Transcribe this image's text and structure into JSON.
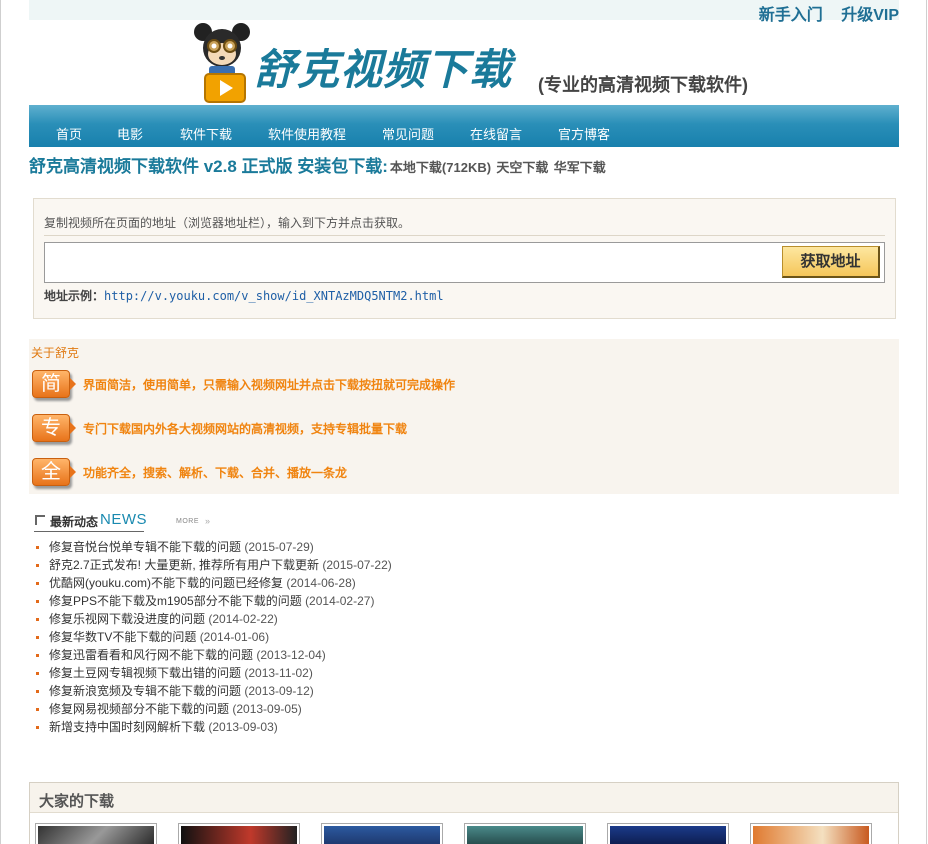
{
  "top_links": {
    "newbie": "新手入门",
    "vip": "升级VIP"
  },
  "logo": {
    "title": "舒克视频下载",
    "subtitle": "(专业的高清视频下载软件)"
  },
  "nav": [
    "首页",
    "电影",
    "软件下载",
    "软件使用教程",
    "常见问题",
    "在线留言",
    "官方博客"
  ],
  "download": {
    "title": "舒克高清视频下载软件 v2.8 正式版 安装包下载:",
    "local": "本地下载(712KB)",
    "tiankong": "天空下载",
    "huajun": "华军下载"
  },
  "fetch": {
    "hint": "复制视频所在页面的地址（浏览器地址栏），输入到下方并点击获取。",
    "input_value": "",
    "button": "获取地址",
    "example_label": "地址示例：",
    "example_url": "http://v.youku.com/v_show/id_XNTAzMDQ5NTM2.html"
  },
  "about": {
    "title": "关于舒克",
    "features": [
      {
        "badge": "简",
        "text": "界面简洁，使用简单，只需输入视频网址并点击下载按扭就可完成操作"
      },
      {
        "badge": "专",
        "text": "专门下载国内外各大视频网站的高清视频，支持专辑批量下载"
      },
      {
        "badge": "全",
        "text": "功能齐全，搜索、解析、下载、合并、播放一条龙"
      }
    ]
  },
  "news": {
    "title_cn": "最新动态",
    "title_en": "NEWS",
    "more": "MORE",
    "items": [
      {
        "text": "修复音悦台悦单专辑不能下载的问题",
        "date": "(2015-07-29)"
      },
      {
        "text": "舒克2.7正式发布! 大量更新, 推荐所有用户下载更新",
        "date": "(2015-07-22)"
      },
      {
        "text": "优酷网(youku.com)不能下载的问题已经修复",
        "date": "(2014-06-28)"
      },
      {
        "text": "修复PPS不能下载及m1905部分不能下载的问题",
        "date": "(2014-02-27)"
      },
      {
        "text": "修复乐视网下载没进度的问题",
        "date": "(2014-02-22)"
      },
      {
        "text": "修复华数TV不能下载的问题",
        "date": "(2014-01-06)"
      },
      {
        "text": "修复迅雷看看和风行网不能下载的问题",
        "date": "(2013-12-04)"
      },
      {
        "text": "修复土豆网专辑视频下载出错的问题",
        "date": "(2013-11-02)"
      },
      {
        "text": "修复新浪宽频及专辑不能下载的问题",
        "date": "(2013-09-12)"
      },
      {
        "text": "修复网易视频部分不能下载的问题",
        "date": "(2013-09-05)"
      },
      {
        "text": "新增支持中国时刻网解析下载",
        "date": "(2013-09-03)"
      }
    ]
  },
  "popular": {
    "title": "大家的下载"
  },
  "colors": {
    "brand": "#1a7a9a",
    "accent": "#f08410",
    "nav": "#2a8fb8"
  }
}
